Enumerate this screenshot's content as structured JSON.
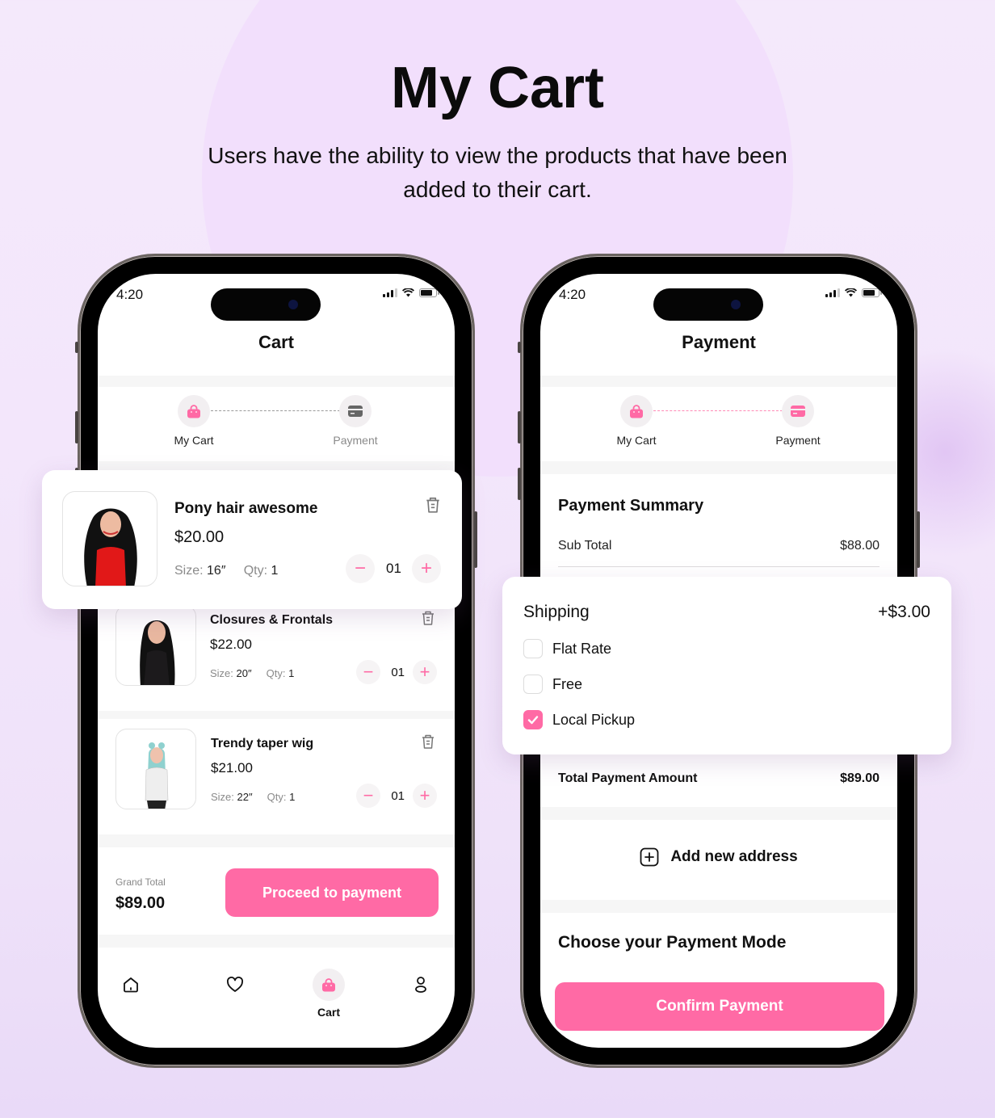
{
  "hero": {
    "title": "My Cart",
    "subtitle": "Users have the ability to view the products that have been added to their cart."
  },
  "theme": {
    "accent": "#ff6aa5",
    "background": "#f4e9fb"
  },
  "status_bar": {
    "time": "4:20",
    "icons": [
      "signal-icon",
      "wifi-icon",
      "battery-icon"
    ]
  },
  "cart_screen": {
    "title": "Cart",
    "steps": [
      {
        "label": "My Cart",
        "icon": "shopping-bag-icon",
        "active": true
      },
      {
        "label": "Payment",
        "icon": "credit-card-icon",
        "active": false
      }
    ],
    "items": [
      {
        "name": "Pony hair awesome",
        "price": "$20.00",
        "size_label": "Size:",
        "size": "16″",
        "qty_label": "Qty:",
        "qty": "1",
        "stepper_value": "01",
        "thumb": "woman-red-top-black-hair"
      },
      {
        "name": "Closures & Frontals",
        "price": "$22.00",
        "size_label": "Size:",
        "size": "20″",
        "qty_label": "Qty:",
        "qty": "1",
        "stepper_value": "01",
        "thumb": "woman-black-top-black-hair"
      },
      {
        "name": "Trendy taper wig",
        "price": "$21.00",
        "size_label": "Size:",
        "size": "22″",
        "qty_label": "Qty:",
        "qty": "1",
        "stepper_value": "01",
        "thumb": "woman-teal-wig"
      }
    ],
    "grand_total_label": "Grand Total",
    "grand_total": "$89.00",
    "proceed_button": "Proceed to payment",
    "tabbar": [
      {
        "name": "home",
        "icon": "home-icon",
        "label": ""
      },
      {
        "name": "wishlist",
        "icon": "heart-icon",
        "label": ""
      },
      {
        "name": "cart",
        "icon": "shopping-bag-icon",
        "label": "Cart",
        "active": true
      },
      {
        "name": "profile",
        "icon": "user-icon",
        "label": ""
      }
    ]
  },
  "payment_screen": {
    "title": "Payment",
    "steps": [
      {
        "label": "My Cart",
        "icon": "shopping-bag-icon",
        "active": true
      },
      {
        "label": "Payment",
        "icon": "credit-card-icon",
        "active": true
      }
    ],
    "summary_title": "Payment Summary",
    "sub_total_label": "Sub Total",
    "sub_total": "$88.00",
    "shipping": {
      "label": "Shipping",
      "amount": "+$3.00",
      "options": [
        {
          "label": "Flat Rate",
          "checked": false
        },
        {
          "label": "Free",
          "checked": false
        },
        {
          "label": "Local Pickup",
          "checked": true
        }
      ]
    },
    "total_label": "Total Payment Amount",
    "total": "$89.00",
    "add_address": "Add new address",
    "mode_title": "Choose your Payment Mode",
    "confirm_button": "Confirm Payment"
  }
}
